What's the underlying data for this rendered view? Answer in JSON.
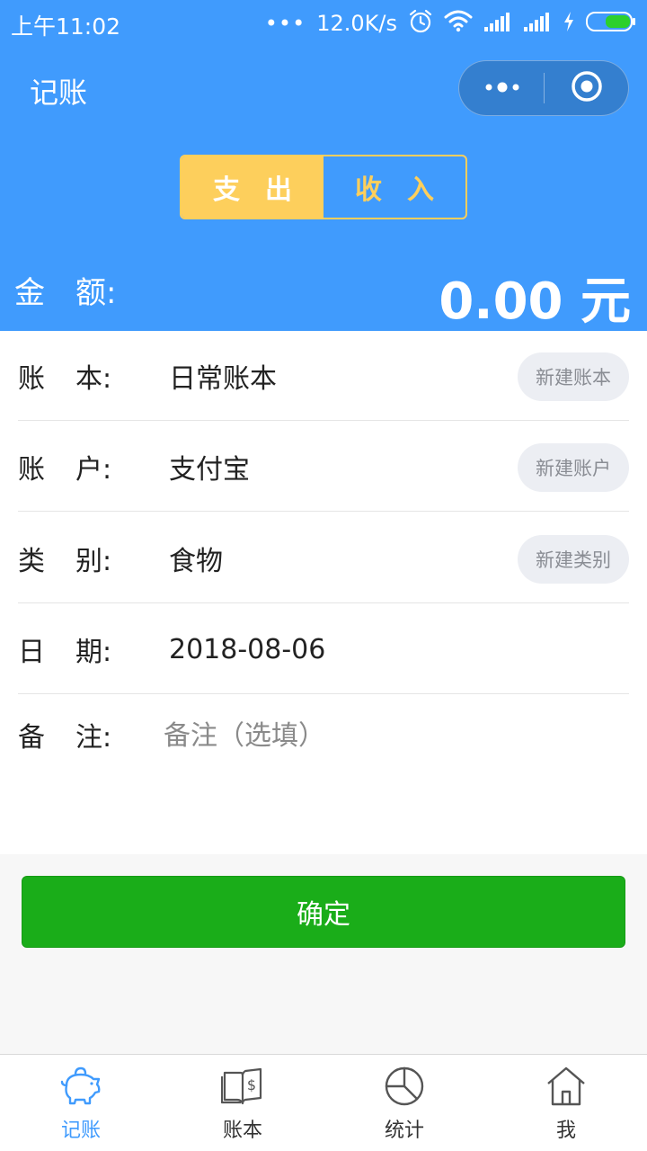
{
  "status_bar": {
    "time": "上午11:02",
    "dots": "•••",
    "speed": "12.0K/s"
  },
  "navbar": {
    "title": "记账",
    "more_icon": "more-dots-icon",
    "close_icon": "target-circle-icon"
  },
  "type_toggle": {
    "expense": "支出",
    "income": "收入",
    "selected": "expense"
  },
  "amount": {
    "label": "金额:",
    "label_char1": "金",
    "label_rest": "额:",
    "value": "0.00 元"
  },
  "form": {
    "book": {
      "label_char1": "账",
      "label_rest": "本:",
      "value": "日常账本",
      "button": "新建账本"
    },
    "account": {
      "label_char1": "账",
      "label_rest": "户:",
      "value": "支付宝",
      "button": "新建账户"
    },
    "category": {
      "label_char1": "类",
      "label_rest": "别:",
      "value": "食物",
      "button": "新建类别"
    },
    "date": {
      "label_char1": "日",
      "label_rest": "期:",
      "value": "2018-08-06"
    },
    "note": {
      "label_char1": "备",
      "label_rest": "注:",
      "placeholder": "备注（选填）"
    }
  },
  "confirm_label": "确定",
  "tabbar": {
    "items": [
      {
        "label": "记账",
        "icon": "piggy-bank-icon",
        "active": true
      },
      {
        "label": "账本",
        "icon": "ledger-book-icon",
        "active": false
      },
      {
        "label": "统计",
        "icon": "pie-chart-icon",
        "active": false
      },
      {
        "label": "我",
        "icon": "home-icon",
        "active": false
      }
    ]
  },
  "colors": {
    "header_blue": "#409bfd",
    "toggle_yellow": "#fdcf5c",
    "confirm_green": "#1aad19",
    "tab_active": "#409bfd"
  }
}
